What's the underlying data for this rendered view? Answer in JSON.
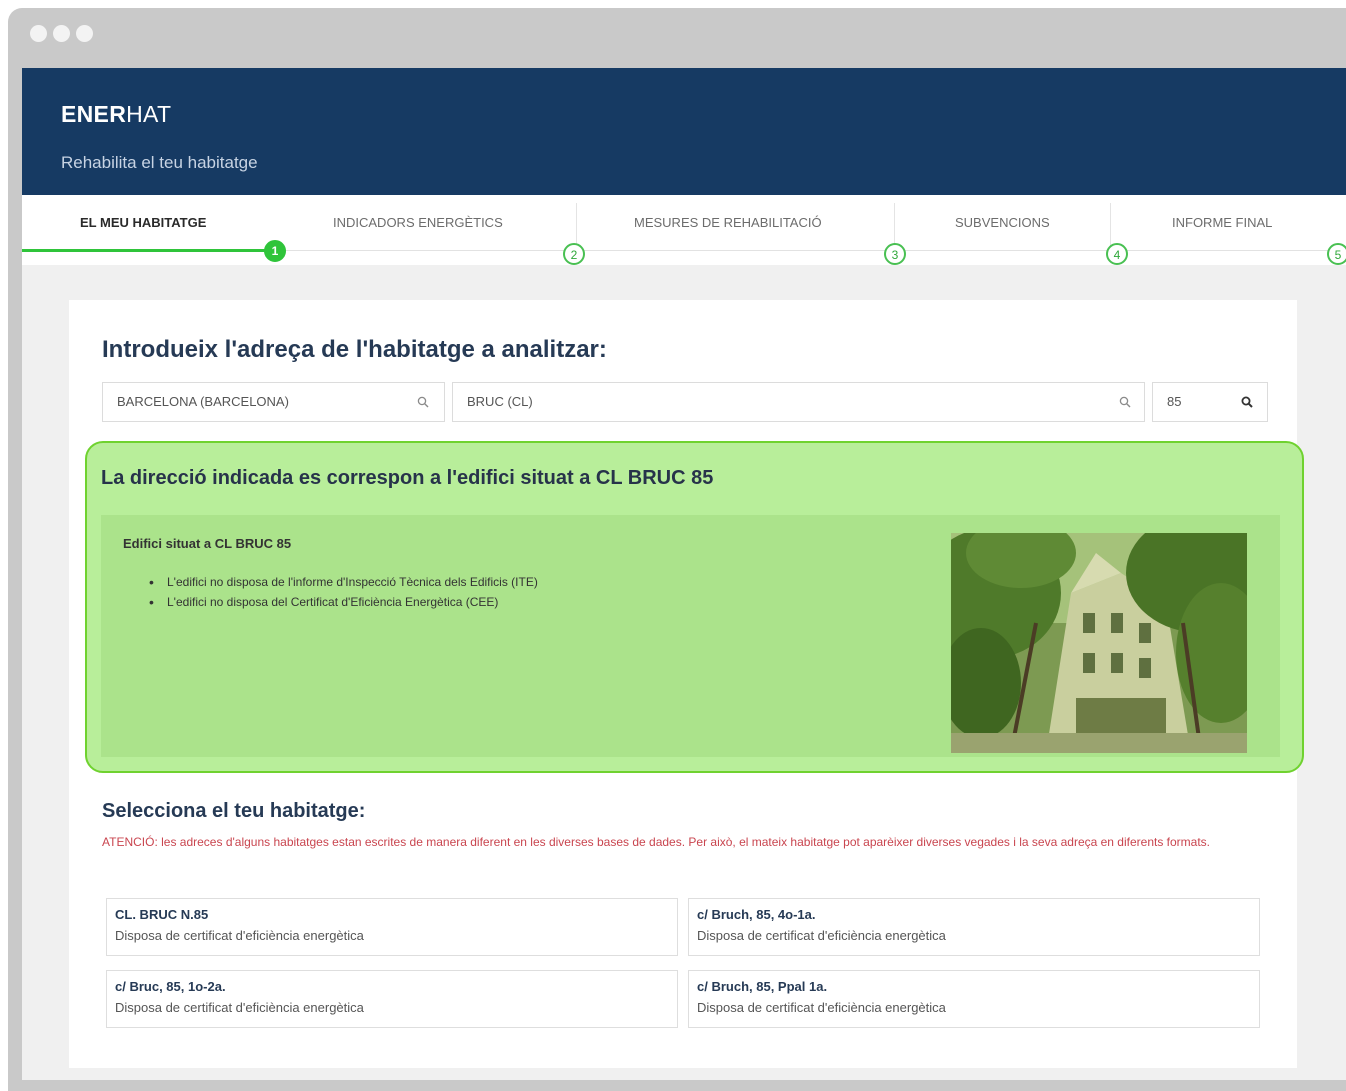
{
  "window": {
    "controls": [
      "close",
      "minimize",
      "maximize"
    ]
  },
  "header": {
    "brand_bold": "ENER",
    "brand_rest": "HAT",
    "tagline": "Rehabilita el teu habitatge",
    "background": "#163a63"
  },
  "steps": {
    "items": [
      {
        "label": "EL MEU HABITATGE",
        "number": "1",
        "active": true
      },
      {
        "label": "INDICADORS ENERGÈTICS",
        "number": "2",
        "active": false
      },
      {
        "label": "MESURES DE REHABILITACIÓ",
        "number": "3",
        "active": false
      },
      {
        "label": "SUBVENCIONS",
        "number": "4",
        "active": false
      },
      {
        "label": "INFORME FINAL",
        "number": "5",
        "active": false
      }
    ],
    "accent": "#2fc43a"
  },
  "address": {
    "title": "Introdueix l'adreça de l'habitatge a analitzar:",
    "municipality": "BARCELONA (BARCELONA)",
    "street": "BRUC (CL)",
    "number": "85"
  },
  "building": {
    "heading": "La direcció indicada es correspon a l'edifici situat a CL BRUC 85",
    "subheading": "Edifici situat a CL BRUC 85",
    "facts": [
      "L'edifici no disposa de l'informe d'Inspecció Tècnica dels Edificis (ITE)",
      "L'edifici no disposa del Certificat d'Eficiència Energètica (CEE)"
    ],
    "highlight_color": "#b8ee9a"
  },
  "dwellings": {
    "title": "Selecciona el teu habitatge:",
    "warning": "ATENCIÓ: les adreces d'alguns habitatges estan escrites de manera diferent en les diverses bases de dades. Per això, el mateix habitatge pot aparèixer diverses vegades i la seva adreça en diferents formats.",
    "items": [
      {
        "address": "CL. BRUC N.85",
        "status": "Disposa de certificat d'eficiència energètica"
      },
      {
        "address": "c/ Bruch, 85, 4o-1a.",
        "status": "Disposa de certificat d'eficiència energètica"
      },
      {
        "address": "c/ Bruc, 85, 1o-2a.",
        "status": "Disposa de certificat d'eficiència energètica"
      },
      {
        "address": "c/ Bruch, 85, Ppal 1a.",
        "status": "Disposa de certificat d'eficiència energètica"
      }
    ]
  }
}
